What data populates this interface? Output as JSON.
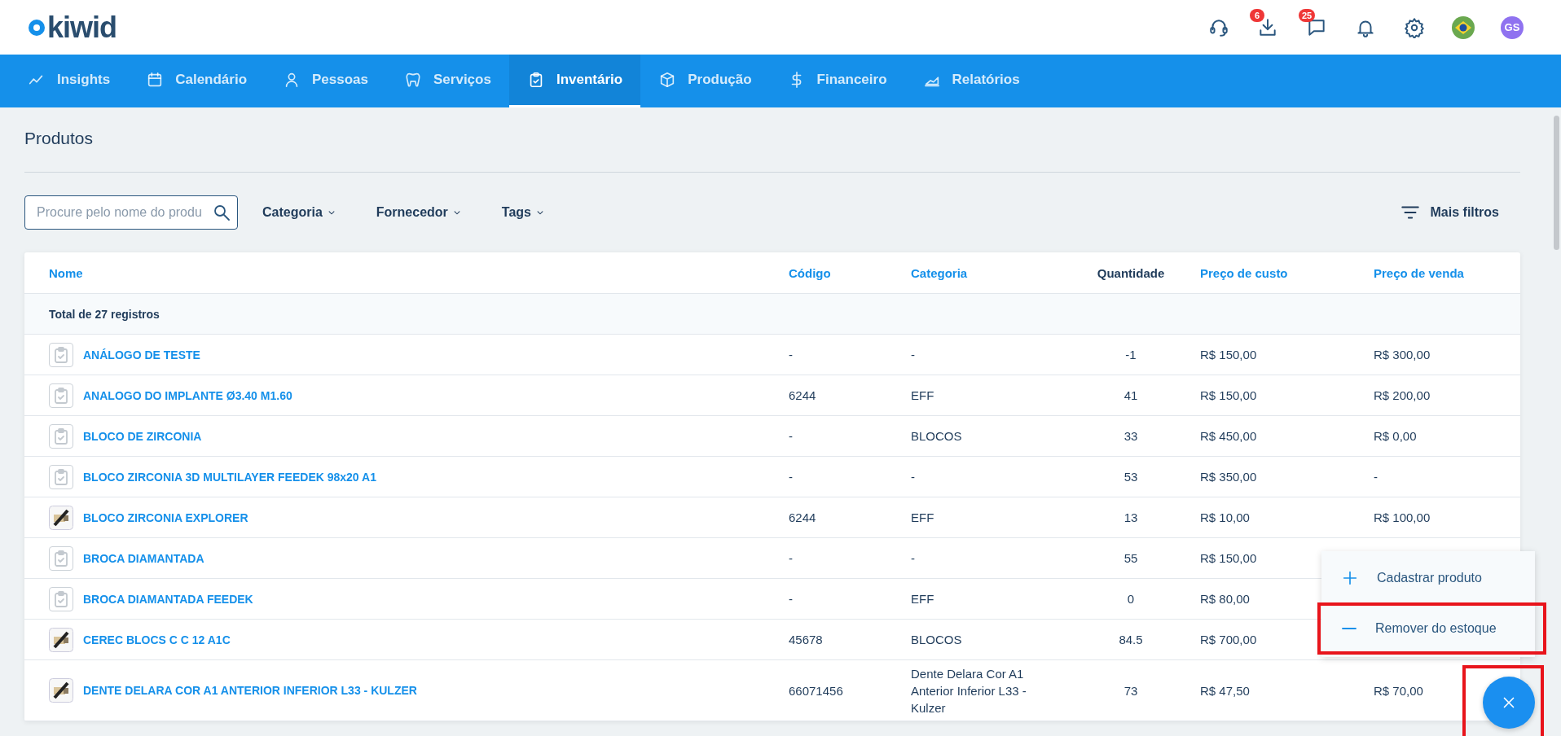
{
  "header": {
    "logo": "kiwid",
    "icons": [
      {
        "kind": "headset"
      },
      {
        "kind": "download",
        "badge": "6"
      },
      {
        "kind": "chat",
        "badge": "25"
      },
      {
        "kind": "bell"
      },
      {
        "kind": "gear"
      },
      {
        "kind": "flag"
      },
      {
        "kind": "avatar",
        "label": "GS"
      }
    ]
  },
  "nav": [
    {
      "label": "Insights",
      "kind": "chart",
      "selected": false
    },
    {
      "label": "Calendário",
      "kind": "calendar",
      "selected": false
    },
    {
      "label": "Pessoas",
      "kind": "person",
      "selected": false
    },
    {
      "label": "Serviços",
      "kind": "tooth",
      "selected": false
    },
    {
      "label": "Inventário",
      "kind": "clipboard",
      "selected": true
    },
    {
      "label": "Produção",
      "kind": "box",
      "selected": false
    },
    {
      "label": "Financeiro",
      "kind": "dollar",
      "selected": false
    },
    {
      "label": "Relatórios",
      "kind": "area",
      "selected": false
    }
  ],
  "page_title": "Produtos",
  "search": {
    "placeholder": "Procure pelo nome do produ"
  },
  "filters": [
    "Categoria",
    "Fornecedor",
    "Tags"
  ],
  "more_filters": "Mais filtros",
  "table": {
    "columns": [
      {
        "label": "Nome",
        "sortable": true
      },
      {
        "label": "Código",
        "sortable": true
      },
      {
        "label": "Categoria",
        "sortable": true
      },
      {
        "label": "Quantidade",
        "sortable": false
      },
      {
        "label": "Preço de custo",
        "sortable": true
      },
      {
        "label": "Preço de venda",
        "sortable": true
      }
    ],
    "total": "Total de 27 registros",
    "rows": [
      {
        "kind": "placeholder",
        "name": "ANÁLOGO DE TESTE",
        "code": "-",
        "category": "-",
        "quantity": "-1",
        "cost": "R$ 150,00",
        "price": "R$ 300,00"
      },
      {
        "kind": "placeholder",
        "name": "ANALOGO DO IMPLANTE Ø3.40 M1.60",
        "code": "6244",
        "category": "EFF",
        "quantity": "41",
        "cost": "R$ 150,00",
        "price": "R$ 200,00"
      },
      {
        "kind": "placeholder",
        "name": "BLOCO DE ZIRCONIA",
        "code": "-",
        "category": "BLOCOS",
        "quantity": "33",
        "cost": "R$ 450,00",
        "price": "R$ 0,00"
      },
      {
        "kind": "placeholder",
        "name": "BLOCO ZIRCONIA 3D MULTILAYER FEEDEK 98x20 A1",
        "code": "-",
        "category": "-",
        "quantity": "53",
        "cost": "R$ 350,00",
        "price": "-"
      },
      {
        "kind": "picture",
        "name": "BLOCO ZIRCONIA EXPLORER",
        "code": "6244",
        "category": "EFF",
        "quantity": "13",
        "cost": "R$ 10,00",
        "price": "R$ 100,00"
      },
      {
        "kind": "placeholder",
        "name": "BROCA DIAMANTADA",
        "code": "-",
        "category": "-",
        "quantity": "55",
        "cost": "R$ 150,00"
      },
      {
        "kind": "placeholder",
        "name": "BROCA DIAMANTADA FEEDEK",
        "code": "-",
        "category": "EFF",
        "quantity": "0",
        "cost": "R$ 80,00"
      },
      {
        "kind": "picture",
        "name": "CEREC BLOCS C C 12 A1C",
        "code": "45678",
        "category": "BLOCOS",
        "quantity": "84.5",
        "cost": "R$ 700,00"
      },
      {
        "kind": "picture",
        "name": "DENTE DELARA COR A1 ANTERIOR INFERIOR L33 - KULZER",
        "code": "66071456",
        "category": "Dente Delara Cor A1 Anterior Inferior L33 - Kulzer",
        "quantity": "73",
        "cost": "R$ 47,50",
        "price": "R$ 70,00"
      }
    ]
  },
  "fab_menu": {
    "open": true,
    "items": [
      {
        "kind": "plus",
        "label": "Cadastrar produto",
        "highlighted": false
      },
      {
        "kind": "minus",
        "label": "Remover do estoque",
        "highlighted": true
      }
    ],
    "fab_highlighted": true
  }
}
